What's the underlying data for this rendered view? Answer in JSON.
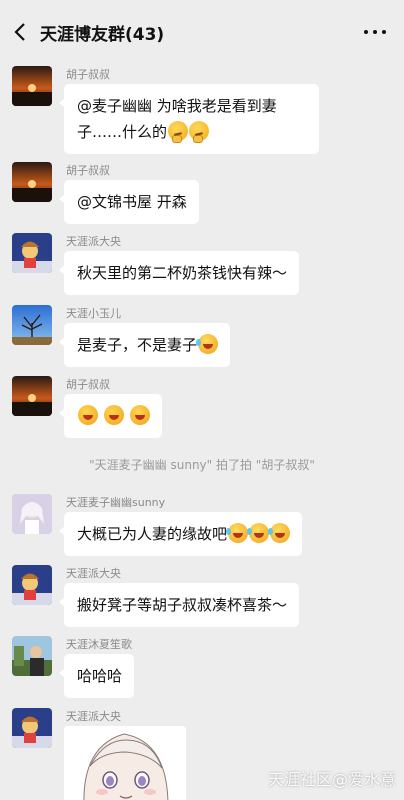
{
  "header": {
    "title": "天涯博友群(43)",
    "back_icon": "chevron-left-icon",
    "more_icon": "more-horizontal-icon"
  },
  "messages": [
    {
      "sender": "胡子叔叔",
      "text": "@麦子幽幽  为啥我老是看到妻",
      "text2": "子……什么的"
    },
    {
      "sender": "胡子叔叔",
      "text": "@文锦书屋  开森"
    },
    {
      "sender": "天涯派大央",
      "text": "秋天里的第二杯奶茶钱快有辣～"
    },
    {
      "sender": "天涯小玉儿",
      "text": "是麦子，不是妻子"
    },
    {
      "sender": "胡子叔叔",
      "text": ""
    },
    {
      "sender": "天涯麦子幽幽sunny",
      "text": "大概已为人妻的缘故吧"
    },
    {
      "sender": "天涯派大央",
      "text": "搬好凳子等胡子叔叔凑杯喜茶～"
    },
    {
      "sender": "天涯沐夏笙歌",
      "text": "哈哈哈"
    },
    {
      "sender": "天涯派大央",
      "text": ""
    }
  ],
  "system_notice": "\"天涯麦子幽幽 sunny\" 拍了拍 \"胡子叔叔\"",
  "watermark": "天涯社区@爱水意",
  "colors": {
    "background": "#ededed",
    "bubble": "#ffffff",
    "sender_text": "#8a8a8a",
    "notice_text": "#9a9a9a"
  }
}
